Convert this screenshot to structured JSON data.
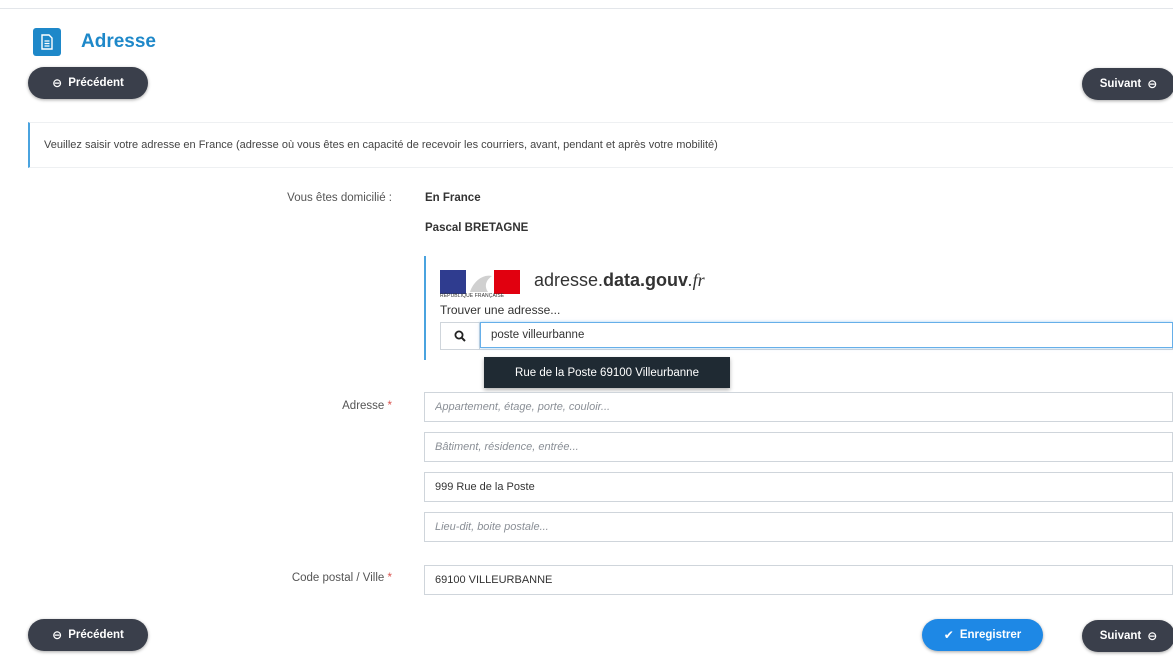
{
  "colors": {
    "accent": "#1e88c9",
    "pill_dark": "#3a3f4b",
    "save_blue": "#1e88e5",
    "info_border": "#4aa3df"
  },
  "header": {
    "title": "Adresse",
    "icon": "document-icon"
  },
  "nav": {
    "previous_label": "Précédent",
    "next_label": "Suivant",
    "save_label": "Enregistrer"
  },
  "info": {
    "text": "Veuillez saisir votre adresse en France (adresse où vous êtes en capacité de recevoir les courriers, avant, pendant et après votre mobilité)"
  },
  "domicile": {
    "label": "Vous êtes domicilié :",
    "value": "En France",
    "name": "Pascal BRETAGNE"
  },
  "address_search": {
    "brand_prefix": "adresse.",
    "brand_bold": "data.gouv",
    "brand_suffix": ".fr",
    "logo_text": "RÉPUBLIQUE FRANÇAISE",
    "find_label": "Trouver une adresse...",
    "query": "poste villeurbanne",
    "suggestion": "Rue de la Poste 69100 Villeurbanne"
  },
  "address": {
    "label": "Adresse",
    "required_mark": "*",
    "line1_placeholder": "Appartement, étage, porte, couloir...",
    "line2_placeholder": "Bâtiment, résidence, entrée...",
    "line3_value": "999 Rue de la Poste",
    "line4_placeholder": "Lieu-dit, boite postale..."
  },
  "city": {
    "label": "Code postal / Ville",
    "required_mark": "*",
    "value": "69100 VILLEURBANNE"
  }
}
